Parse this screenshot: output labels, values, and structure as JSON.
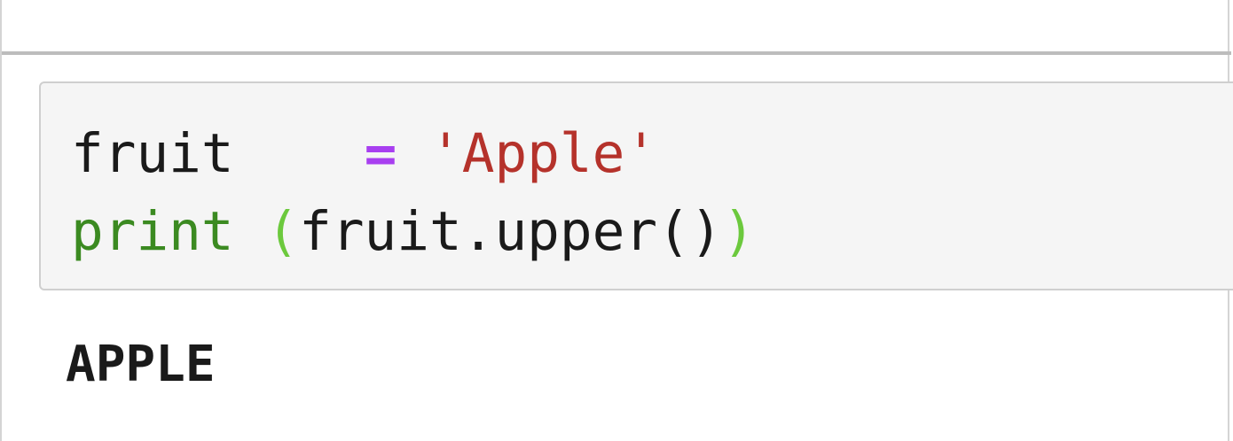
{
  "code_cell": {
    "line1": {
      "var": "fruit",
      "spacing": "   ",
      "op": "=",
      "str": "'Apple'"
    },
    "line2": {
      "func": "print",
      "open_paren": "(",
      "call": "fruit.upper()",
      "close_paren": ")"
    }
  },
  "output_cell": {
    "text": "APPLE"
  },
  "colors": {
    "builtin": "#3b8a21",
    "operator": "#a83ff0",
    "string": "#b5322b",
    "paren": "#6cc93d",
    "input_bg": "#f5f5f5"
  }
}
